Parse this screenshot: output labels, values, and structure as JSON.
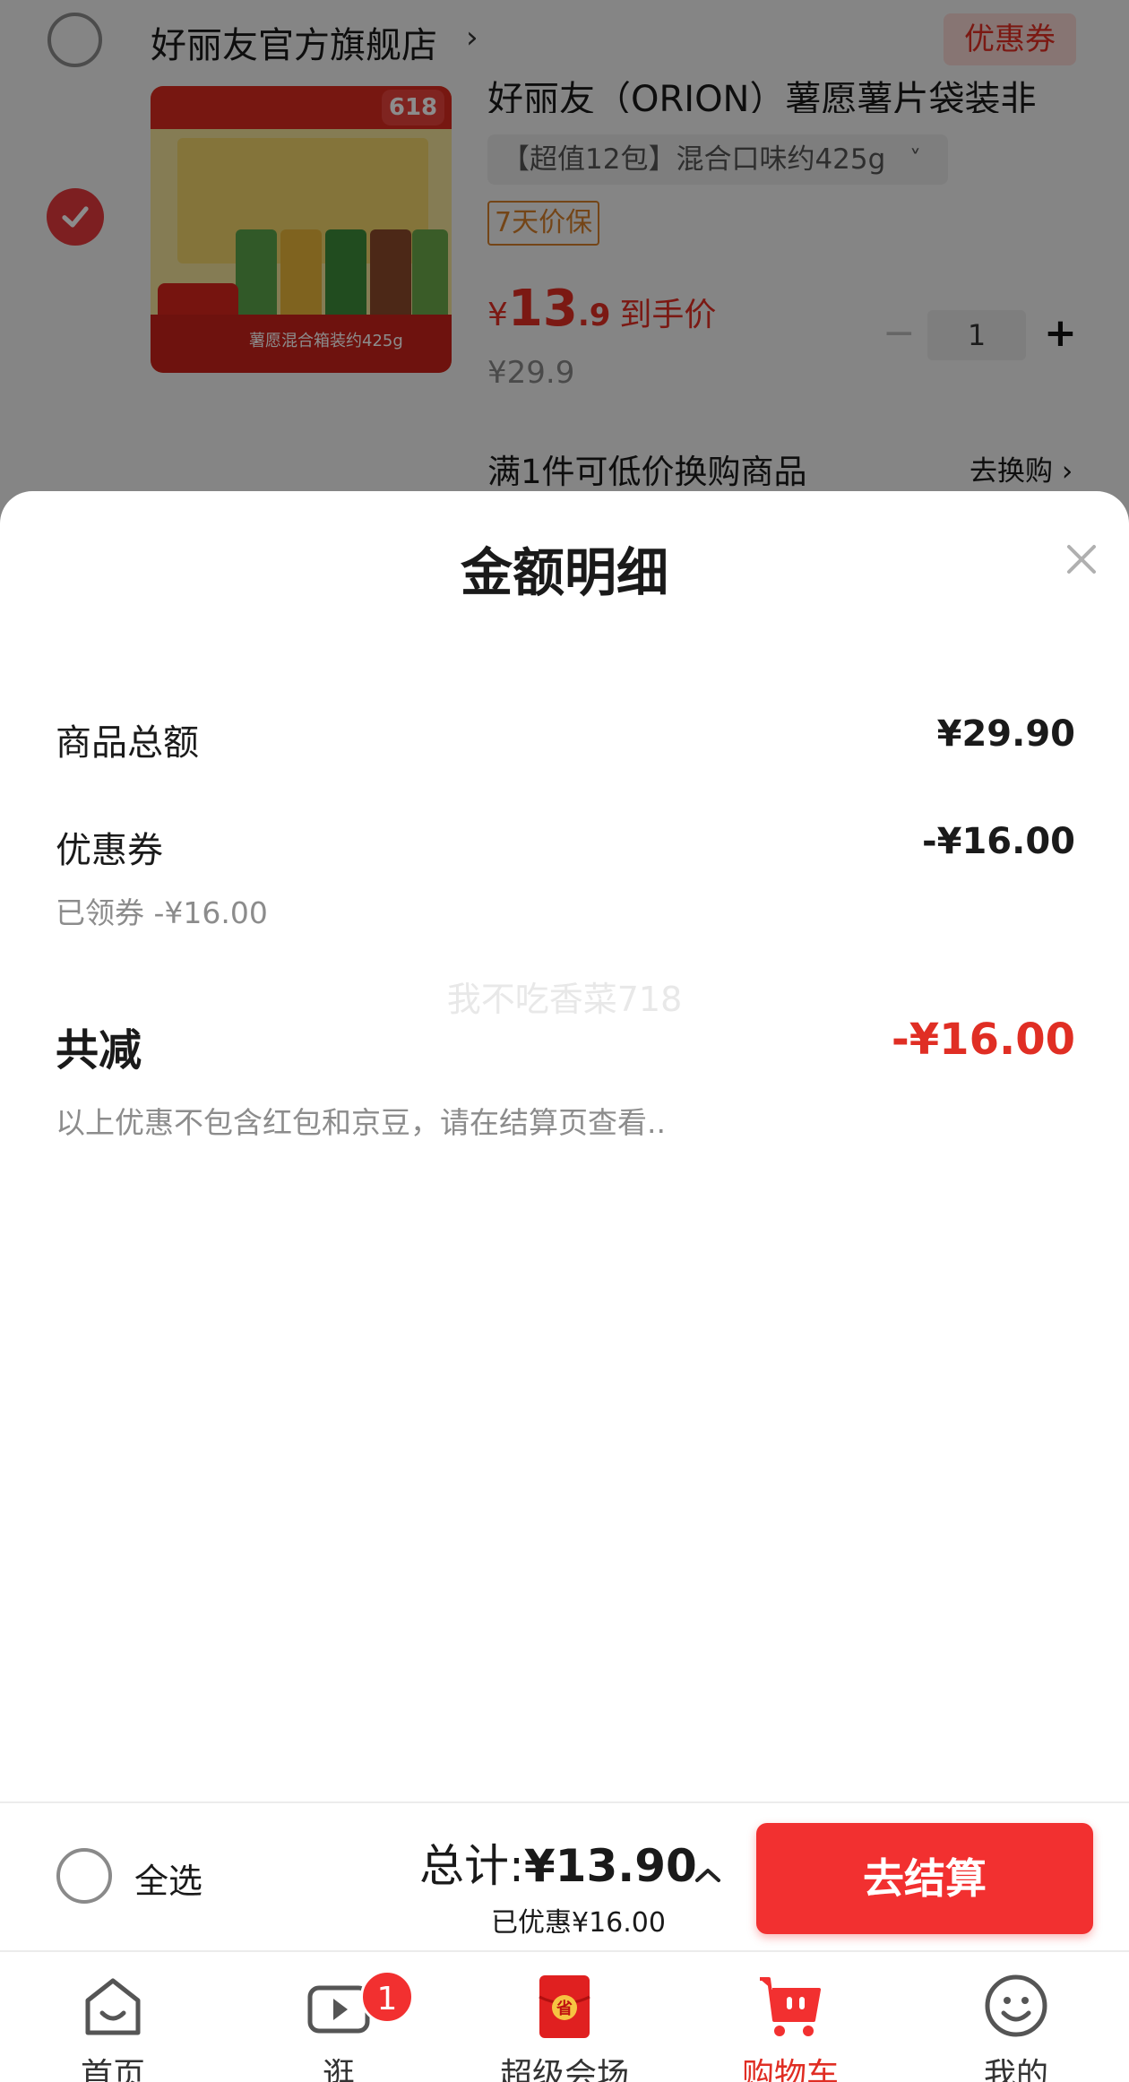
{
  "store": {
    "name": "好丽友官方旗舰店",
    "chevron": "›",
    "coupon_label": "优惠券"
  },
  "product": {
    "title": "好丽友（ORION）薯愿薯片袋装非",
    "spec": "【超值12包】混合口味约425g",
    "spec_chevron": "˅",
    "guarantee": "7天价保",
    "price_symbol": "¥",
    "price_int": "13",
    "price_dec": ".9",
    "price_tail": "到手价",
    "original_price": "¥29.9",
    "quantity": "1",
    "qty_minus": "−",
    "qty_plus": "+",
    "image_badge": "618",
    "image_caption": "薯愿混合箱装约425g"
  },
  "exchange": {
    "text": "满1件可低价换购商品",
    "link": "去换购 ›"
  },
  "sheet": {
    "title": "金额明细",
    "rows": [
      {
        "label": "商品总额",
        "value": "¥29.90"
      },
      {
        "label": "优惠券",
        "value": "-¥16.00",
        "note": "已领券 -¥16.00"
      }
    ],
    "total_label": "共减",
    "total_value": "-¥16.00",
    "footnote": "以上优惠不包含红包和京豆，请在结算页查看..",
    "watermark": "我不吃香菜718"
  },
  "checkout": {
    "select_all": "全选",
    "total_prefix": "总计:",
    "total_value": "¥13.90",
    "saved": "已优惠¥16.00",
    "button": "去结算"
  },
  "tabs": [
    {
      "label": "首页",
      "icon": "home-icon"
    },
    {
      "label": "逛",
      "icon": "video-icon",
      "badge": "1"
    },
    {
      "label": "超级会场",
      "icon": "red-envelope-icon"
    },
    {
      "label": "购物车",
      "icon": "cart-icon",
      "active": true
    },
    {
      "label": "我的",
      "icon": "smile-icon"
    }
  ],
  "colors": {
    "accent": "#e02e24",
    "checkout_button": "#f23030"
  }
}
